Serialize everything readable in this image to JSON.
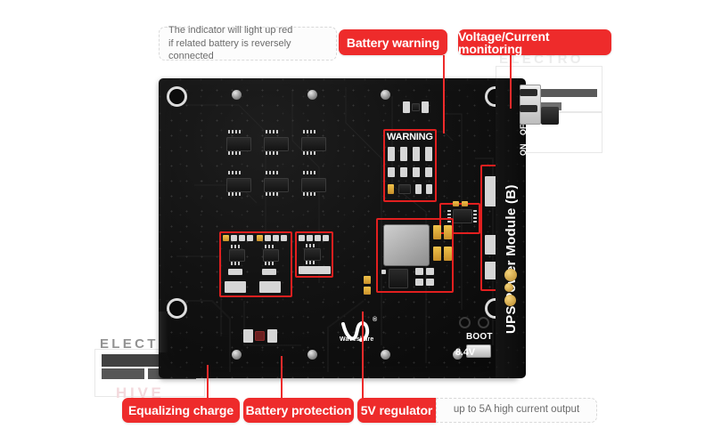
{
  "document": {
    "title": "UPS Power Module (B) annotated product photo",
    "background": "#ffffff"
  },
  "colors": {
    "accent_red": "#ee2b2b",
    "box_red": "#e21f1f",
    "tooltip_bg": "#fcfcfc",
    "tooltip_border": "#d9d9d9",
    "tooltip_text": "#6b6b6b",
    "pcb_black": "#121212",
    "silkscreen_white": "#ffffff",
    "pad_gold": "#d6a23a"
  },
  "callouts": {
    "top": [
      {
        "id": "indicator-tooltip",
        "kind": "tooltip",
        "line1": "The indicator will light up red",
        "line2": "if related battery is reversely connected"
      },
      {
        "id": "battery-warning",
        "kind": "label",
        "text": "Battery warning"
      },
      {
        "id": "voltage-current-monitoring",
        "kind": "label",
        "text": "Voltage/Current monitoring"
      }
    ],
    "bottom": [
      {
        "id": "equalizing-charge",
        "kind": "label",
        "text": "Equalizing charge"
      },
      {
        "id": "battery-protection",
        "kind": "label",
        "text": "Battery protection"
      },
      {
        "id": "five-volt-regulator",
        "kind": "label",
        "text": "5V regulator"
      },
      {
        "id": "current-output-tooltip",
        "kind": "tooltip",
        "text": "up to 5A high current output"
      }
    ]
  },
  "board": {
    "silkscreen": {
      "warning": "WARNING",
      "product_name": "UPS Power Module (B)",
      "switch_on": "ON",
      "switch_off": "OFF",
      "boot": "BOOT",
      "voltage": "8.4V",
      "brand": "Waveshare",
      "brand_mark": "®"
    }
  },
  "watermarks": {
    "top_right": "ELECTRO",
    "bottom_left_electro": "ELECTRO",
    "bottom_left_hive": "HIVE"
  }
}
